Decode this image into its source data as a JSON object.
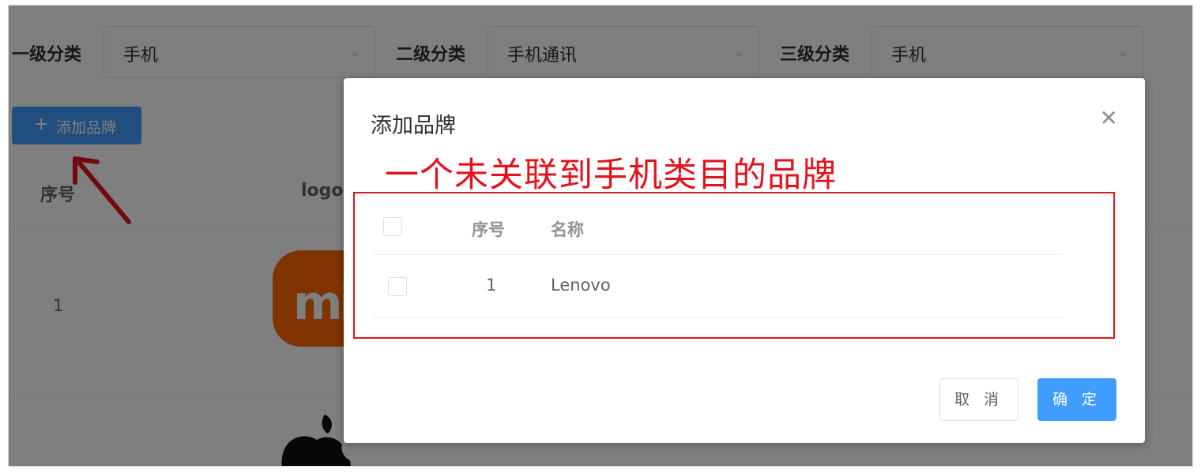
{
  "filters": [
    {
      "label": "一级分类",
      "value": "手机"
    },
    {
      "label": "二级分类",
      "value": "手机通讯"
    },
    {
      "label": "三级分类",
      "value": "手机"
    }
  ],
  "page": {
    "add_button_label": "添加品牌",
    "columns": {
      "index": "序号",
      "logo": "logo"
    },
    "first_row_index": "1",
    "logo_text": "mi"
  },
  "dialog": {
    "title": "添加品牌",
    "annotation": "一个未关联到手机类目的品牌",
    "table": {
      "headers": {
        "index": "序号",
        "name": "名称"
      },
      "rows": [
        {
          "index": "1",
          "name": "Lenovo"
        }
      ]
    },
    "cancel_label": "取 消",
    "confirm_label": "确 定"
  },
  "colors": {
    "primary": "#409eff",
    "annotation_red": "#e0141e",
    "mi_orange": "#ff6900"
  }
}
